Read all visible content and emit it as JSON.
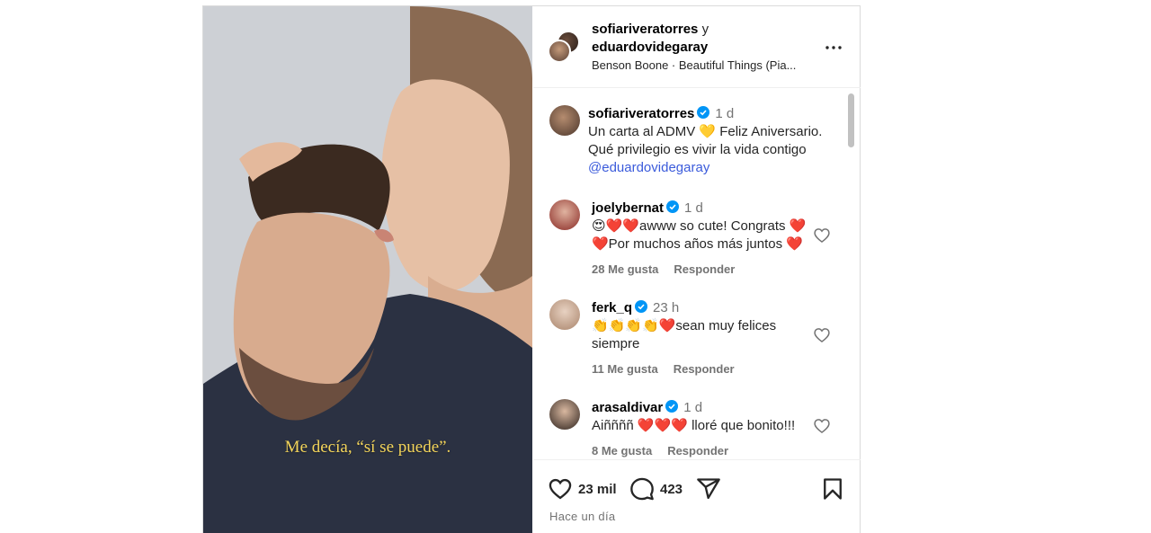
{
  "media": {
    "overlay_caption": "Me decía, “sí se puede”."
  },
  "header": {
    "user1": "sofiariveratorres",
    "conjunction": "y",
    "user2": "eduardovidegaray",
    "music": "Benson Boone · Beautiful Things (Pia..."
  },
  "caption": {
    "username": "sofiariveratorres",
    "time": "1 d",
    "line1": "Un carta al ADMV 💛 Feliz Aniversario.",
    "line2": "Qué privilegio es vivir la vida contigo",
    "mention": "@eduardovidegaray"
  },
  "comments": [
    {
      "username": "joelybernat",
      "time": "1 d",
      "line1": "😍❤️❤️awww so cute! Congrats ❤️",
      "line2": "❤️Por muchos años más juntos ❤️",
      "likes": "28 Me gusta",
      "reply": "Responder"
    },
    {
      "username": "ferk_q",
      "time": "23 h",
      "line1": "👏👏👏👏❤️sean muy felices",
      "line2": "siempre",
      "likes": "11 Me gusta",
      "reply": "Responder"
    },
    {
      "username": "arasaldivar",
      "time": "1 d",
      "line1": "Aiññññ ❤️❤️❤️ lloré que bonito!!!",
      "line2": "",
      "likes": "8 Me gusta",
      "reply": "Responder"
    }
  ],
  "actions": {
    "likes_count": "23 mil",
    "comments_count": "423",
    "posted": "Hace un día"
  },
  "colors": {
    "verified": "#0095f6",
    "mention": "#3b5bdb",
    "overlay_text": "#f3d45a"
  }
}
